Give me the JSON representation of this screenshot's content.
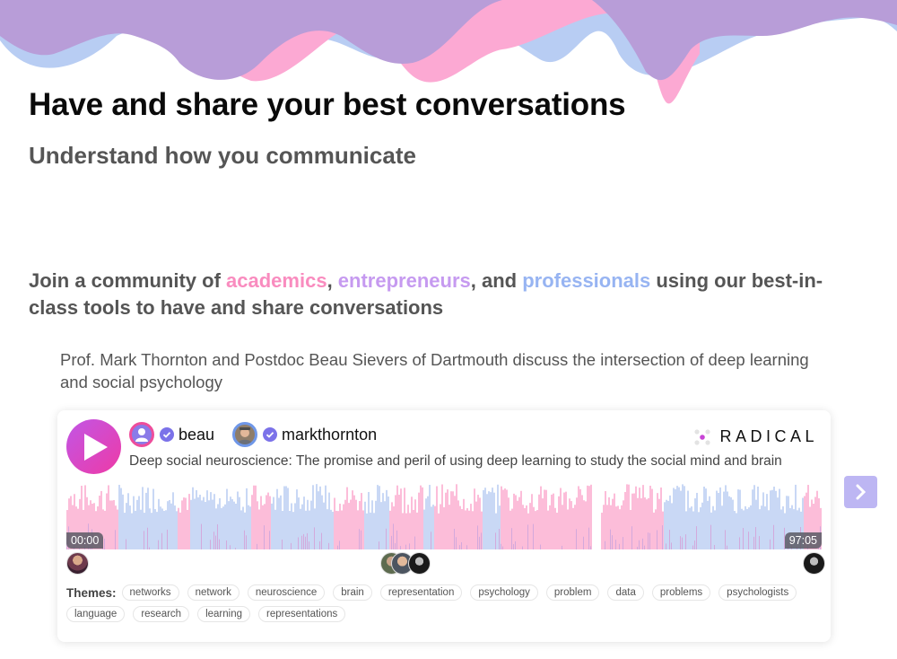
{
  "hero": {
    "headline": "Have and share your best conversations",
    "subheadline": "Understand how you communicate"
  },
  "community": {
    "prefix": "Join a community of ",
    "academics": "academics",
    "sep1": ", ",
    "entrepreneurs": "entrepreneurs",
    "sep2": ", and ",
    "professionals": "professionals",
    "suffix": " using our best-in-class tools to have and share conversations",
    "colors": {
      "academics": "#f98cbf",
      "entrepreneurs": "#c69af0",
      "professionals": "#97b4f2"
    }
  },
  "description": "Prof. Mark Thornton and Postdoc Beau Sievers of Dartmouth discuss the intersection of deep learning and social psychology",
  "player": {
    "play_icon": "play-icon",
    "participants": [
      {
        "name": "beau",
        "verified": true
      },
      {
        "name": "markthornton",
        "verified": true
      }
    ],
    "brand": "RADICAL",
    "title": "Deep social neuroscience: The promise and peril of using deep learning to study the social mind and brain",
    "time_start": "00:00",
    "time_end": "97:05",
    "waveform_colors": {
      "speaker_a": "#fcbdd9",
      "speaker_b": "#c9d8f5",
      "overlap": "#d3a9dc"
    },
    "themes_label": "Themes:",
    "themes": [
      "networks",
      "network",
      "neuroscience",
      "brain",
      "representation",
      "psychology",
      "problem",
      "data",
      "problems",
      "psychologists",
      "language",
      "research",
      "learning",
      "representations"
    ]
  },
  "carousel": {
    "next_icon": "chevron-right-icon"
  },
  "colors": {
    "wave_purple": "#b89dd8",
    "wave_blue": "#b8cdf3",
    "wave_pink": "#fca9d3",
    "play_gradient_start": "#c156e6",
    "play_gradient_end": "#ee3aa6",
    "next_button": "#bdb6f3"
  }
}
